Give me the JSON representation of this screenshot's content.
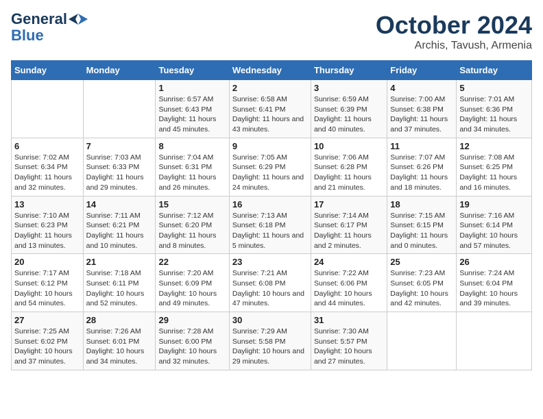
{
  "header": {
    "logo_line1": "General",
    "logo_line2": "Blue",
    "month": "October 2024",
    "location": "Archis, Tavush, Armenia"
  },
  "weekdays": [
    "Sunday",
    "Monday",
    "Tuesday",
    "Wednesday",
    "Thursday",
    "Friday",
    "Saturday"
  ],
  "weeks": [
    [
      {
        "day": "",
        "sunrise": "",
        "sunset": "",
        "daylight": ""
      },
      {
        "day": "",
        "sunrise": "",
        "sunset": "",
        "daylight": ""
      },
      {
        "day": "1",
        "sunrise": "Sunrise: 6:57 AM",
        "sunset": "Sunset: 6:43 PM",
        "daylight": "Daylight: 11 hours and 45 minutes."
      },
      {
        "day": "2",
        "sunrise": "Sunrise: 6:58 AM",
        "sunset": "Sunset: 6:41 PM",
        "daylight": "Daylight: 11 hours and 43 minutes."
      },
      {
        "day": "3",
        "sunrise": "Sunrise: 6:59 AM",
        "sunset": "Sunset: 6:39 PM",
        "daylight": "Daylight: 11 hours and 40 minutes."
      },
      {
        "day": "4",
        "sunrise": "Sunrise: 7:00 AM",
        "sunset": "Sunset: 6:38 PM",
        "daylight": "Daylight: 11 hours and 37 minutes."
      },
      {
        "day": "5",
        "sunrise": "Sunrise: 7:01 AM",
        "sunset": "Sunset: 6:36 PM",
        "daylight": "Daylight: 11 hours and 34 minutes."
      }
    ],
    [
      {
        "day": "6",
        "sunrise": "Sunrise: 7:02 AM",
        "sunset": "Sunset: 6:34 PM",
        "daylight": "Daylight: 11 hours and 32 minutes."
      },
      {
        "day": "7",
        "sunrise": "Sunrise: 7:03 AM",
        "sunset": "Sunset: 6:33 PM",
        "daylight": "Daylight: 11 hours and 29 minutes."
      },
      {
        "day": "8",
        "sunrise": "Sunrise: 7:04 AM",
        "sunset": "Sunset: 6:31 PM",
        "daylight": "Daylight: 11 hours and 26 minutes."
      },
      {
        "day": "9",
        "sunrise": "Sunrise: 7:05 AM",
        "sunset": "Sunset: 6:29 PM",
        "daylight": "Daylight: 11 hours and 24 minutes."
      },
      {
        "day": "10",
        "sunrise": "Sunrise: 7:06 AM",
        "sunset": "Sunset: 6:28 PM",
        "daylight": "Daylight: 11 hours and 21 minutes."
      },
      {
        "day": "11",
        "sunrise": "Sunrise: 7:07 AM",
        "sunset": "Sunset: 6:26 PM",
        "daylight": "Daylight: 11 hours and 18 minutes."
      },
      {
        "day": "12",
        "sunrise": "Sunrise: 7:08 AM",
        "sunset": "Sunset: 6:25 PM",
        "daylight": "Daylight: 11 hours and 16 minutes."
      }
    ],
    [
      {
        "day": "13",
        "sunrise": "Sunrise: 7:10 AM",
        "sunset": "Sunset: 6:23 PM",
        "daylight": "Daylight: 11 hours and 13 minutes."
      },
      {
        "day": "14",
        "sunrise": "Sunrise: 7:11 AM",
        "sunset": "Sunset: 6:21 PM",
        "daylight": "Daylight: 11 hours and 10 minutes."
      },
      {
        "day": "15",
        "sunrise": "Sunrise: 7:12 AM",
        "sunset": "Sunset: 6:20 PM",
        "daylight": "Daylight: 11 hours and 8 minutes."
      },
      {
        "day": "16",
        "sunrise": "Sunrise: 7:13 AM",
        "sunset": "Sunset: 6:18 PM",
        "daylight": "Daylight: 11 hours and 5 minutes."
      },
      {
        "day": "17",
        "sunrise": "Sunrise: 7:14 AM",
        "sunset": "Sunset: 6:17 PM",
        "daylight": "Daylight: 11 hours and 2 minutes."
      },
      {
        "day": "18",
        "sunrise": "Sunrise: 7:15 AM",
        "sunset": "Sunset: 6:15 PM",
        "daylight": "Daylight: 11 hours and 0 minutes."
      },
      {
        "day": "19",
        "sunrise": "Sunrise: 7:16 AM",
        "sunset": "Sunset: 6:14 PM",
        "daylight": "Daylight: 10 hours and 57 minutes."
      }
    ],
    [
      {
        "day": "20",
        "sunrise": "Sunrise: 7:17 AM",
        "sunset": "Sunset: 6:12 PM",
        "daylight": "Daylight: 10 hours and 54 minutes."
      },
      {
        "day": "21",
        "sunrise": "Sunrise: 7:18 AM",
        "sunset": "Sunset: 6:11 PM",
        "daylight": "Daylight: 10 hours and 52 minutes."
      },
      {
        "day": "22",
        "sunrise": "Sunrise: 7:20 AM",
        "sunset": "Sunset: 6:09 PM",
        "daylight": "Daylight: 10 hours and 49 minutes."
      },
      {
        "day": "23",
        "sunrise": "Sunrise: 7:21 AM",
        "sunset": "Sunset: 6:08 PM",
        "daylight": "Daylight: 10 hours and 47 minutes."
      },
      {
        "day": "24",
        "sunrise": "Sunrise: 7:22 AM",
        "sunset": "Sunset: 6:06 PM",
        "daylight": "Daylight: 10 hours and 44 minutes."
      },
      {
        "day": "25",
        "sunrise": "Sunrise: 7:23 AM",
        "sunset": "Sunset: 6:05 PM",
        "daylight": "Daylight: 10 hours and 42 minutes."
      },
      {
        "day": "26",
        "sunrise": "Sunrise: 7:24 AM",
        "sunset": "Sunset: 6:04 PM",
        "daylight": "Daylight: 10 hours and 39 minutes."
      }
    ],
    [
      {
        "day": "27",
        "sunrise": "Sunrise: 7:25 AM",
        "sunset": "Sunset: 6:02 PM",
        "daylight": "Daylight: 10 hours and 37 minutes."
      },
      {
        "day": "28",
        "sunrise": "Sunrise: 7:26 AM",
        "sunset": "Sunset: 6:01 PM",
        "daylight": "Daylight: 10 hours and 34 minutes."
      },
      {
        "day": "29",
        "sunrise": "Sunrise: 7:28 AM",
        "sunset": "Sunset: 6:00 PM",
        "daylight": "Daylight: 10 hours and 32 minutes."
      },
      {
        "day": "30",
        "sunrise": "Sunrise: 7:29 AM",
        "sunset": "Sunset: 5:58 PM",
        "daylight": "Daylight: 10 hours and 29 minutes."
      },
      {
        "day": "31",
        "sunrise": "Sunrise: 7:30 AM",
        "sunset": "Sunset: 5:57 PM",
        "daylight": "Daylight: 10 hours and 27 minutes."
      },
      {
        "day": "",
        "sunrise": "",
        "sunset": "",
        "daylight": ""
      },
      {
        "day": "",
        "sunrise": "",
        "sunset": "",
        "daylight": ""
      }
    ]
  ]
}
